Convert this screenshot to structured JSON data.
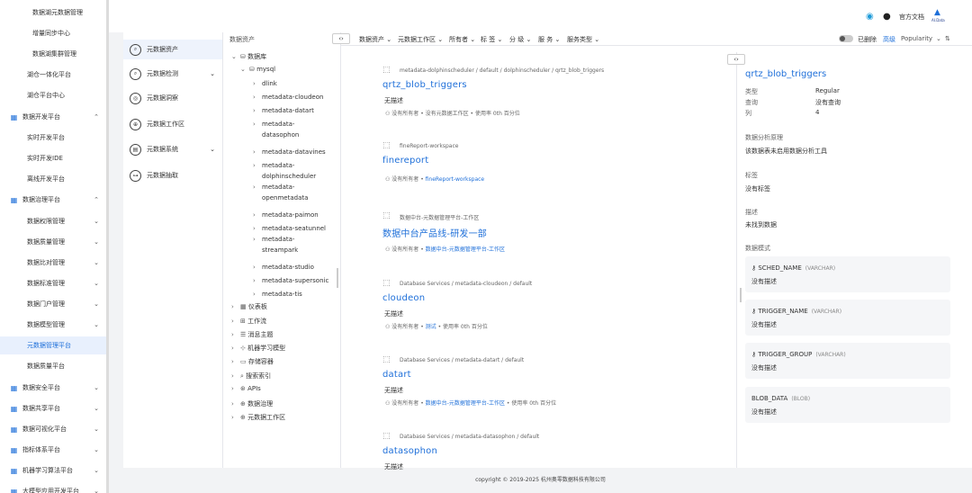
{
  "leftnav": {
    "items": [
      {
        "label": "数据湖元数据管理",
        "level": 2
      },
      {
        "label": "增量同步中心",
        "level": 2
      },
      {
        "label": "数据湖集群管理",
        "level": 2
      },
      {
        "label": "湖仓一体化平台",
        "level": 1
      },
      {
        "label": "湖仓平台中心",
        "level": 1
      },
      {
        "label": "数据开发平台",
        "level": 0,
        "chev": "^"
      },
      {
        "label": "实时开发平台",
        "level": 1
      },
      {
        "label": "实时开发IDE",
        "level": 1
      },
      {
        "label": "离线开发平台",
        "level": 1
      },
      {
        "label": "数据治理平台",
        "level": 0,
        "chev": "^"
      },
      {
        "label": "数据权限管理",
        "level": 1,
        "chev": "v"
      },
      {
        "label": "数据质量管理",
        "level": 1,
        "chev": "v"
      },
      {
        "label": "数据比对管理",
        "level": 1,
        "chev": "v"
      },
      {
        "label": "数据标准管理",
        "level": 1,
        "chev": "v"
      },
      {
        "label": "数据门户管理",
        "level": 1,
        "chev": "v"
      },
      {
        "label": "数据模型管理",
        "level": 1,
        "chev": "v"
      },
      {
        "label": "元数据管理平台",
        "level": 1,
        "active": true
      },
      {
        "label": "数据质量平台",
        "level": 1
      },
      {
        "label": "数据安全平台",
        "level": 0,
        "chev": "v"
      },
      {
        "label": "数据共享平台",
        "level": 0,
        "chev": "v"
      },
      {
        "label": "数据可视化平台",
        "level": 0,
        "chev": "v"
      },
      {
        "label": "指标体系平台",
        "level": 0,
        "chev": "v"
      },
      {
        "label": "机器学习算法平台",
        "level": 0,
        "chev": "v"
      },
      {
        "label": "大模型应用开发平台",
        "level": 0,
        "chev": "v"
      }
    ]
  },
  "header": {
    "docs": "官方文档",
    "logo_text": "AI.Data"
  },
  "side": {
    "items": [
      {
        "label": "元数据资产",
        "icon": "⌕",
        "active": true
      },
      {
        "label": "元数据检测",
        "icon": "⌕",
        "chev": true
      },
      {
        "label": "元数据洞察",
        "icon": "◎"
      },
      {
        "label": "元数据工作区",
        "icon": "⊕"
      },
      {
        "label": "元数据系统",
        "icon": "▤",
        "chev": true
      },
      {
        "label": "元数据抽取",
        "icon": "⊶"
      }
    ]
  },
  "tree": {
    "title": "数据资产",
    "root": "数据库",
    "mysql": "mysql",
    "children": [
      "dlink",
      "metadata-cloudeon",
      "metadata-datart",
      "metadata-",
      "datasophon",
      "metadata-datavines",
      "metadata-",
      "dolphinscheduler",
      "metadata-",
      "openmetadata",
      "metadata-paimon",
      "metadata-seatunnel",
      "metadata-",
      "streampark",
      "metadata-studio",
      "metadata-supersonic",
      "metadata-tis"
    ],
    "others": [
      "仪表板",
      "工作流",
      "消息主题",
      "机器学习模型",
      "存储容器",
      "搜索索引",
      "APIs",
      "数据治理",
      "元数据工作区"
    ]
  },
  "filters": {
    "items": [
      "数据资产",
      "元数据工作区",
      "所有者",
      "标 签",
      "分 级",
      "服 务",
      "服务类型"
    ],
    "deleted": "已删除",
    "advanced": "高级",
    "sort": "Popularity"
  },
  "cards": [
    {
      "crumb": "metadata-dolphinscheduler  /  default  /  dolphinscheduler  /  qrtz_blob_triggers",
      "title": "qrtz_blob_triggers",
      "desc": "无描述",
      "meta": "没有所有者 •  没有元数据工作区 •  使用率 0th 百分位",
      "link": ""
    },
    {
      "crumb": "fineReport-workspace",
      "title": "finereport",
      "desc": "",
      "meta": "没有所有者 •  ",
      "link": "fineReport-workspace"
    },
    {
      "crumb": "数据中台-元数据管理平台-工作区",
      "title": "数据中台产品线-研发一部",
      "desc": "",
      "meta": "没有所有者 •  ",
      "link": "数据中台-元数据管理平台-工作区"
    },
    {
      "crumb": "Database Services  /  metadata-cloudeon  /  default",
      "title": "cloudeon",
      "desc": "无描述",
      "meta": "没有所有者 •  ",
      "link": "测试",
      "meta2": " •  使用率 0th 百分位"
    },
    {
      "crumb": "Database Services  /  metadata-datart  /  default",
      "title": "datart",
      "desc": "无描述",
      "meta": "没有所有者 •  ",
      "link": "数据中台-元数据管理平台-工作区",
      "meta2": " •  使用率 0th 百分位"
    },
    {
      "crumb": "Database Services  /  metadata-datasophon  /  default",
      "title": "datasophon",
      "desc": "无描述",
      "meta": "",
      "link": ""
    }
  ],
  "detail": {
    "title": "qrtz_blob_triggers",
    "props": [
      {
        "k": "类型",
        "v": "Regular"
      },
      {
        "k": "查询",
        "v": "没有查询"
      },
      {
        "k": "列",
        "v": "4"
      }
    ],
    "analysis_label": "数据分析原理",
    "analysis_value": "该数据表未启用数据分析工具",
    "tags_label": "标签",
    "tags_value": "没有标签",
    "desc_label": "描述",
    "desc_value": "未找到数据",
    "schema_label": "数据模式",
    "fields": [
      {
        "name": "SCHED_NAME",
        "type": "(VARCHAR)",
        "desc": "没有描述"
      },
      {
        "name": "TRIGGER_NAME",
        "type": "(VARCHAR)",
        "desc": "没有描述"
      },
      {
        "name": "TRIGGER_GROUP",
        "type": "(VARCHAR)",
        "desc": "没有描述"
      },
      {
        "name": "BLOB_DATA",
        "type": "(BLOB)",
        "desc": "没有描述"
      }
    ]
  },
  "footer": "copyright © 2019-2025 杭州奥零数据科技有限公司"
}
